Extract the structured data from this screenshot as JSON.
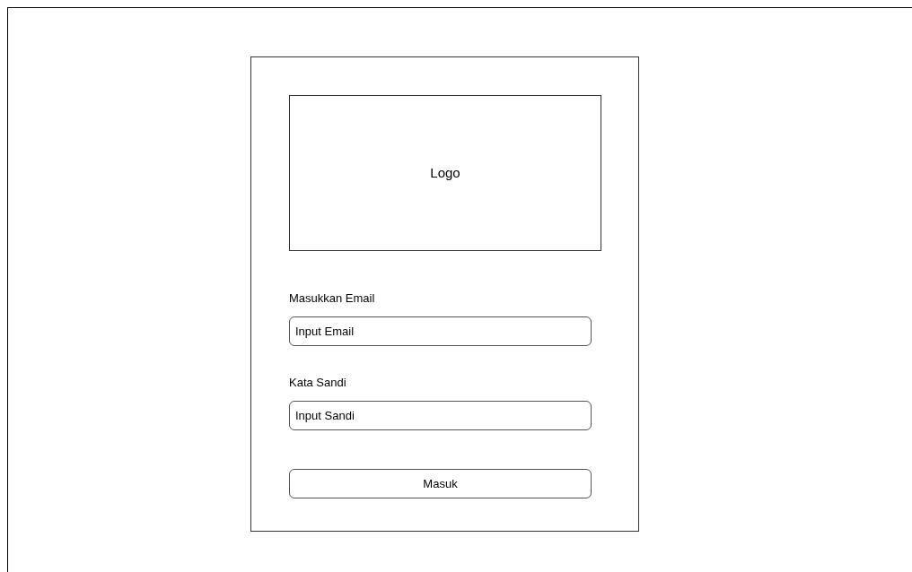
{
  "logo": {
    "label": "Logo"
  },
  "fields": [
    {
      "label": "Masukkan Email",
      "value": "Input Email"
    },
    {
      "label": "Kata Sandi",
      "value": "Input Sandi"
    }
  ],
  "submit": {
    "label": "Masuk"
  }
}
